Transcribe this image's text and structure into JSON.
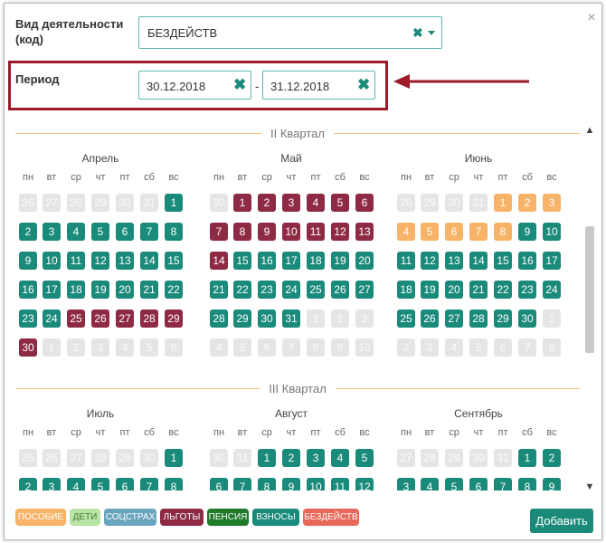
{
  "form": {
    "activity_label": "Вид деятельности (код)",
    "activity_value": "БЕЗДЕЙСТВ",
    "period_label": "Период",
    "date_from": "30.12.2018",
    "date_separator": "-",
    "date_to": "31.12.2018",
    "close_glyph": "×",
    "clear_glyph": "✖"
  },
  "weekdays": [
    "пн",
    "вт",
    "ср",
    "чт",
    "пт",
    "сб",
    "вс"
  ],
  "calendar": {
    "quarters": [
      {
        "title": "II Квартал",
        "months": [
          {
            "name": "Апрель",
            "weeks": [
              [
                [
                  "26",
                  "g"
                ],
                [
                  "27",
                  "g"
                ],
                [
                  "28",
                  "g"
                ],
                [
                  "29",
                  "g"
                ],
                [
                  "30",
                  "g"
                ],
                [
                  "31",
                  "g"
                ],
                [
                  "1",
                  "t"
                ]
              ],
              [
                [
                  "2",
                  "t"
                ],
                [
                  "3",
                  "t"
                ],
                [
                  "4",
                  "t"
                ],
                [
                  "5",
                  "t"
                ],
                [
                  "6",
                  "t"
                ],
                [
                  "7",
                  "t"
                ],
                [
                  "8",
                  "t"
                ]
              ],
              [
                [
                  "9",
                  "t"
                ],
                [
                  "10",
                  "t"
                ],
                [
                  "11",
                  "t"
                ],
                [
                  "12",
                  "t"
                ],
                [
                  "13",
                  "t"
                ],
                [
                  "14",
                  "t"
                ],
                [
                  "15",
                  "t"
                ]
              ],
              [
                [
                  "16",
                  "t"
                ],
                [
                  "17",
                  "t"
                ],
                [
                  "18",
                  "t"
                ],
                [
                  "19",
                  "t"
                ],
                [
                  "20",
                  "t"
                ],
                [
                  "21",
                  "t"
                ],
                [
                  "22",
                  "t"
                ]
              ],
              [
                [
                  "23",
                  "t"
                ],
                [
                  "24",
                  "t"
                ],
                [
                  "25",
                  "m"
                ],
                [
                  "26",
                  "m"
                ],
                [
                  "27",
                  "m"
                ],
                [
                  "28",
                  "m"
                ],
                [
                  "29",
                  "m"
                ]
              ],
              [
                [
                  "30",
                  "m"
                ],
                [
                  "1",
                  "g"
                ],
                [
                  "2",
                  "g"
                ],
                [
                  "3",
                  "g"
                ],
                [
                  "4",
                  "g"
                ],
                [
                  "5",
                  "g"
                ],
                [
                  "6",
                  "g"
                ]
              ]
            ]
          },
          {
            "name": "Май",
            "weeks": [
              [
                [
                  "30",
                  "g"
                ],
                [
                  "1",
                  "m"
                ],
                [
                  "2",
                  "m"
                ],
                [
                  "3",
                  "m"
                ],
                [
                  "4",
                  "m"
                ],
                [
                  "5",
                  "m"
                ],
                [
                  "6",
                  "m"
                ]
              ],
              [
                [
                  "7",
                  "m"
                ],
                [
                  "8",
                  "m"
                ],
                [
                  "9",
                  "m"
                ],
                [
                  "10",
                  "m"
                ],
                [
                  "11",
                  "m"
                ],
                [
                  "12",
                  "m"
                ],
                [
                  "13",
                  "m"
                ]
              ],
              [
                [
                  "14",
                  "m"
                ],
                [
                  "15",
                  "t"
                ],
                [
                  "16",
                  "t"
                ],
                [
                  "17",
                  "t"
                ],
                [
                  "18",
                  "t"
                ],
                [
                  "19",
                  "t"
                ],
                [
                  "20",
                  "t"
                ]
              ],
              [
                [
                  "21",
                  "t"
                ],
                [
                  "22",
                  "t"
                ],
                [
                  "23",
                  "t"
                ],
                [
                  "24",
                  "t"
                ],
                [
                  "25",
                  "t"
                ],
                [
                  "26",
                  "t"
                ],
                [
                  "27",
                  "t"
                ]
              ],
              [
                [
                  "28",
                  "t"
                ],
                [
                  "29",
                  "t"
                ],
                [
                  "30",
                  "t"
                ],
                [
                  "31",
                  "t"
                ],
                [
                  "1",
                  "g"
                ],
                [
                  "2",
                  "g"
                ],
                [
                  "3",
                  "g"
                ]
              ],
              [
                [
                  "4",
                  "g"
                ],
                [
                  "5",
                  "g"
                ],
                [
                  "6",
                  "g"
                ],
                [
                  "7",
                  "g"
                ],
                [
                  "8",
                  "g"
                ],
                [
                  "9",
                  "g"
                ],
                [
                  "10",
                  "g"
                ]
              ]
            ]
          },
          {
            "name": "Июнь",
            "weeks": [
              [
                [
                  "28",
                  "g"
                ],
                [
                  "29",
                  "g"
                ],
                [
                  "30",
                  "g"
                ],
                [
                  "31",
                  "g"
                ],
                [
                  "1",
                  "o"
                ],
                [
                  "2",
                  "o"
                ],
                [
                  "3",
                  "o"
                ]
              ],
              [
                [
                  "4",
                  "o"
                ],
                [
                  "5",
                  "o"
                ],
                [
                  "6",
                  "o"
                ],
                [
                  "7",
                  "o"
                ],
                [
                  "8",
                  "o"
                ],
                [
                  "9",
                  "t"
                ],
                [
                  "10",
                  "t"
                ]
              ],
              [
                [
                  "11",
                  "t"
                ],
                [
                  "12",
                  "t"
                ],
                [
                  "13",
                  "t"
                ],
                [
                  "14",
                  "t"
                ],
                [
                  "15",
                  "t"
                ],
                [
                  "16",
                  "t"
                ],
                [
                  "17",
                  "t"
                ]
              ],
              [
                [
                  "18",
                  "t"
                ],
                [
                  "19",
                  "t"
                ],
                [
                  "20",
                  "t"
                ],
                [
                  "21",
                  "t"
                ],
                [
                  "22",
                  "t"
                ],
                [
                  "23",
                  "t"
                ],
                [
                  "24",
                  "t"
                ]
              ],
              [
                [
                  "25",
                  "t"
                ],
                [
                  "26",
                  "t"
                ],
                [
                  "27",
                  "t"
                ],
                [
                  "28",
                  "t"
                ],
                [
                  "29",
                  "t"
                ],
                [
                  "30",
                  "t"
                ],
                [
                  "1",
                  "g"
                ]
              ],
              [
                [
                  "2",
                  "g"
                ],
                [
                  "3",
                  "g"
                ],
                [
                  "4",
                  "g"
                ],
                [
                  "5",
                  "g"
                ],
                [
                  "6",
                  "g"
                ],
                [
                  "7",
                  "g"
                ],
                [
                  "8",
                  "g"
                ]
              ]
            ]
          }
        ]
      },
      {
        "title": "III Квартал",
        "months": [
          {
            "name": "Июль",
            "weeks": [
              [
                [
                  "25",
                  "g"
                ],
                [
                  "26",
                  "g"
                ],
                [
                  "27",
                  "g"
                ],
                [
                  "28",
                  "g"
                ],
                [
                  "29",
                  "g"
                ],
                [
                  "30",
                  "g"
                ],
                [
                  "1",
                  "t"
                ]
              ],
              [
                [
                  "2",
                  "t"
                ],
                [
                  "3",
                  "t"
                ],
                [
                  "4",
                  "t"
                ],
                [
                  "5",
                  "t"
                ],
                [
                  "6",
                  "t"
                ],
                [
                  "7",
                  "t"
                ],
                [
                  "8",
                  "t"
                ]
              ]
            ]
          },
          {
            "name": "Август",
            "weeks": [
              [
                [
                  "30",
                  "g"
                ],
                [
                  "31",
                  "g"
                ],
                [
                  "1",
                  "t"
                ],
                [
                  "2",
                  "t"
                ],
                [
                  "3",
                  "t"
                ],
                [
                  "4",
                  "t"
                ],
                [
                  "5",
                  "t"
                ]
              ],
              [
                [
                  "6",
                  "t"
                ],
                [
                  "7",
                  "t"
                ],
                [
                  "8",
                  "t"
                ],
                [
                  "9",
                  "t"
                ],
                [
                  "10",
                  "t"
                ],
                [
                  "11",
                  "t"
                ],
                [
                  "12",
                  "t"
                ]
              ]
            ]
          },
          {
            "name": "Сентябрь",
            "weeks": [
              [
                [
                  "27",
                  "g"
                ],
                [
                  "28",
                  "g"
                ],
                [
                  "29",
                  "g"
                ],
                [
                  "30",
                  "g"
                ],
                [
                  "31",
                  "g"
                ],
                [
                  "1",
                  "t"
                ],
                [
                  "2",
                  "t"
                ]
              ],
              [
                [
                  "3",
                  "t"
                ],
                [
                  "4",
                  "t"
                ],
                [
                  "5",
                  "t"
                ],
                [
                  "6",
                  "t"
                ],
                [
                  "7",
                  "t"
                ],
                [
                  "8",
                  "t"
                ],
                [
                  "9",
                  "t"
                ]
              ]
            ]
          }
        ]
      }
    ]
  },
  "legend": [
    {
      "label": "ПОСОБИЕ",
      "color": "#f7b367",
      "text_color": "#ffffff"
    },
    {
      "label": "ДЕТИ",
      "color": "#b8e4a6",
      "text_color": "#4a7a3a"
    },
    {
      "label": "СОЦСТРАХ",
      "color": "#6aa5bf",
      "text_color": "#ffffff"
    },
    {
      "label": "ЛЬГОТЫ",
      "color": "#8e2a44",
      "text_color": "#ffffff"
    },
    {
      "label": "ПЕНСИЯ",
      "color": "#1f7a2a",
      "text_color": "#ffffff"
    },
    {
      "label": "ВЗНОСЫ",
      "color": "#1a8a7a",
      "text_color": "#ffffff"
    },
    {
      "label": "БЕЗДЕЙСТВ",
      "color": "#e8685a",
      "text_color": "#ffffff"
    }
  ],
  "actions": {
    "add_label": "Добавить"
  },
  "colors": {
    "teal": "#1a8a7a",
    "maroon": "#8e2a44",
    "orange": "#f7b367",
    "gray": "#e5e5e5",
    "highlight_red": "#9c1a2a"
  },
  "icons": {
    "close": "close-icon",
    "clear": "clear-icon",
    "caret": "caret-down-icon",
    "arrow": "arrow-left-icon"
  }
}
